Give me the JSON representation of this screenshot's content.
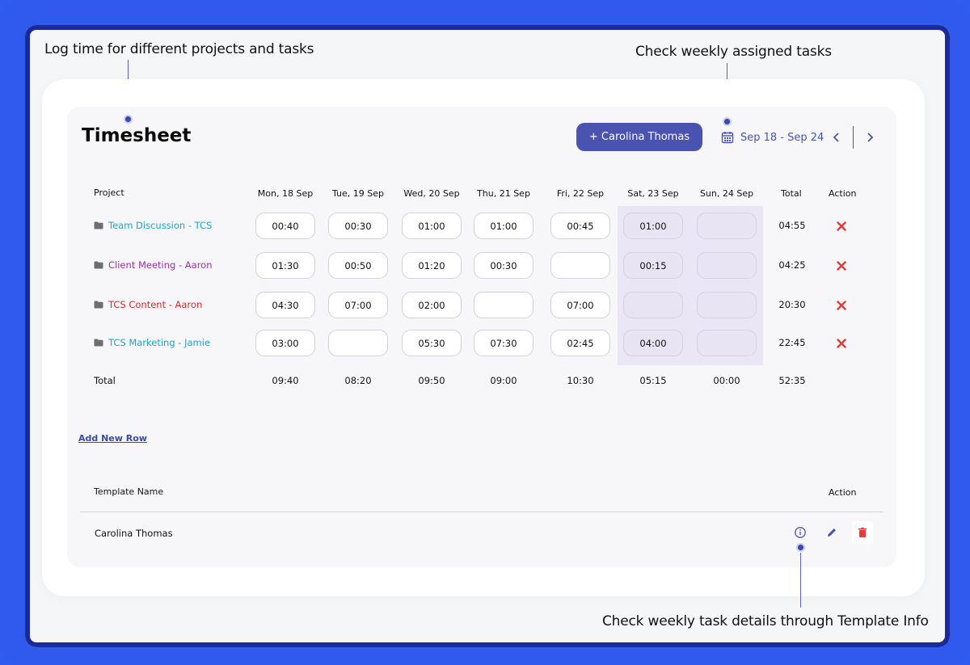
{
  "annotations": {
    "log_time": "Log time for different projects and tasks",
    "weekly_tasks": "Check weekly assigned tasks",
    "template_info": "Check weekly task details through Template Info"
  },
  "header": {
    "title": "Timesheet",
    "user_button": "+ Carolina Thomas",
    "date_range": "Sep 18 - Sep 24",
    "prev_icon": "chevron-left-icon",
    "next_icon": "chevron-right-icon",
    "calendar_icon": "calendar-icon"
  },
  "table": {
    "columns": {
      "project": "Project",
      "days": [
        "Mon, 18 Sep",
        "Tue, 19 Sep",
        "Wed, 20 Sep",
        "Thu, 21 Sep",
        "Fri, 22 Sep",
        "Sat, 23 Sep",
        "Sun, 24 Sep"
      ],
      "total": "Total",
      "action": "Action"
    },
    "rows": [
      {
        "project": "Team Discussion - TCS",
        "color": "#1fa3c9",
        "values": [
          "00:40",
          "00:30",
          "01:00",
          "01:00",
          "00:45",
          "01:00",
          ""
        ],
        "total": "04:55"
      },
      {
        "project": "Client Meeting - Aaron",
        "color": "#9b2fa8",
        "values": [
          "01:30",
          "00:50",
          "01:20",
          "00:30",
          "",
          "00:15",
          ""
        ],
        "total": "04:25"
      },
      {
        "project": "TCS Content - Aaron",
        "color": "#d62b2b",
        "values": [
          "04:30",
          "07:00",
          "02:00",
          "",
          "07:00",
          "",
          ""
        ],
        "total": "20:30"
      },
      {
        "project": "TCS Marketing - Jamie",
        "color": "#1fa3c9",
        "values": [
          "03:00",
          "",
          "05:30",
          "07:30",
          "02:45",
          "04:00",
          ""
        ],
        "total": "22:45"
      }
    ],
    "totals_label": "Total",
    "totals": [
      "09:40",
      "08:20",
      "09:50",
      "09:00",
      "10:30",
      "05:15",
      "00:00"
    ],
    "grand_total": "52:35"
  },
  "add_row": "Add New Row",
  "templates": {
    "name_header": "Template Name",
    "action_header": "Action",
    "items": [
      {
        "name": "Carolina Thomas"
      }
    ]
  },
  "colors": {
    "accent": "#4a54b0",
    "frame": "#3059ee",
    "weekend": "#eae6f6",
    "delete": "#e23b3b"
  }
}
